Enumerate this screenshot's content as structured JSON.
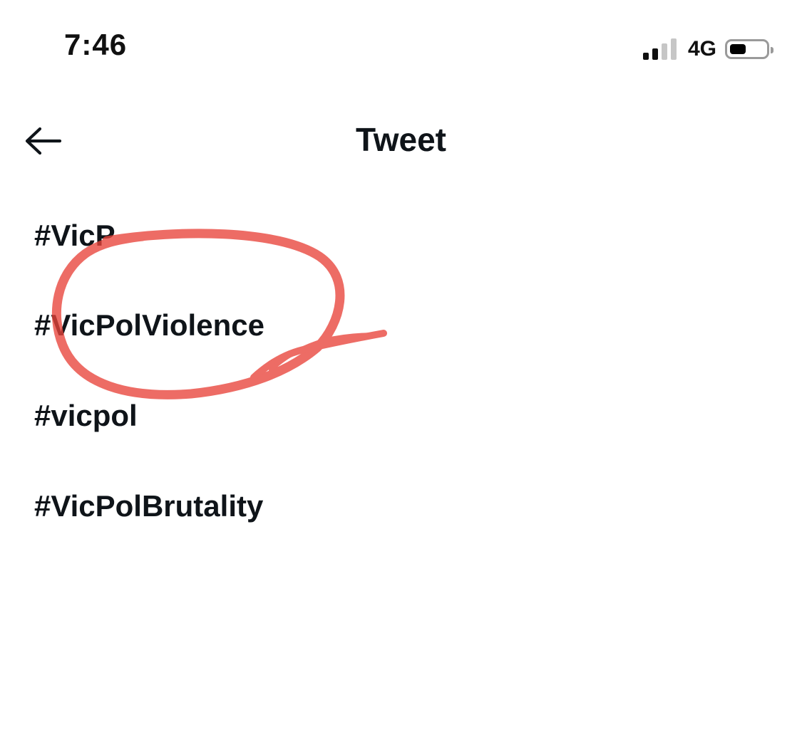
{
  "status_bar": {
    "time": "7:46",
    "network": "4G",
    "signal_bars_active": 2,
    "signal_bars_total": 4,
    "battery_level": 0.45,
    "icons": [
      "signal-icon",
      "battery-icon"
    ]
  },
  "header": {
    "back_icon": "arrow-left-icon",
    "title": "Tweet"
  },
  "hashtags": [
    "#VicP",
    "#VicPolViolence",
    "#vicpol",
    "#VicPolBrutality"
  ],
  "annotation": {
    "color": "#e8433a"
  },
  "colors": {
    "text": "#0f1419",
    "background": "#ffffff"
  }
}
